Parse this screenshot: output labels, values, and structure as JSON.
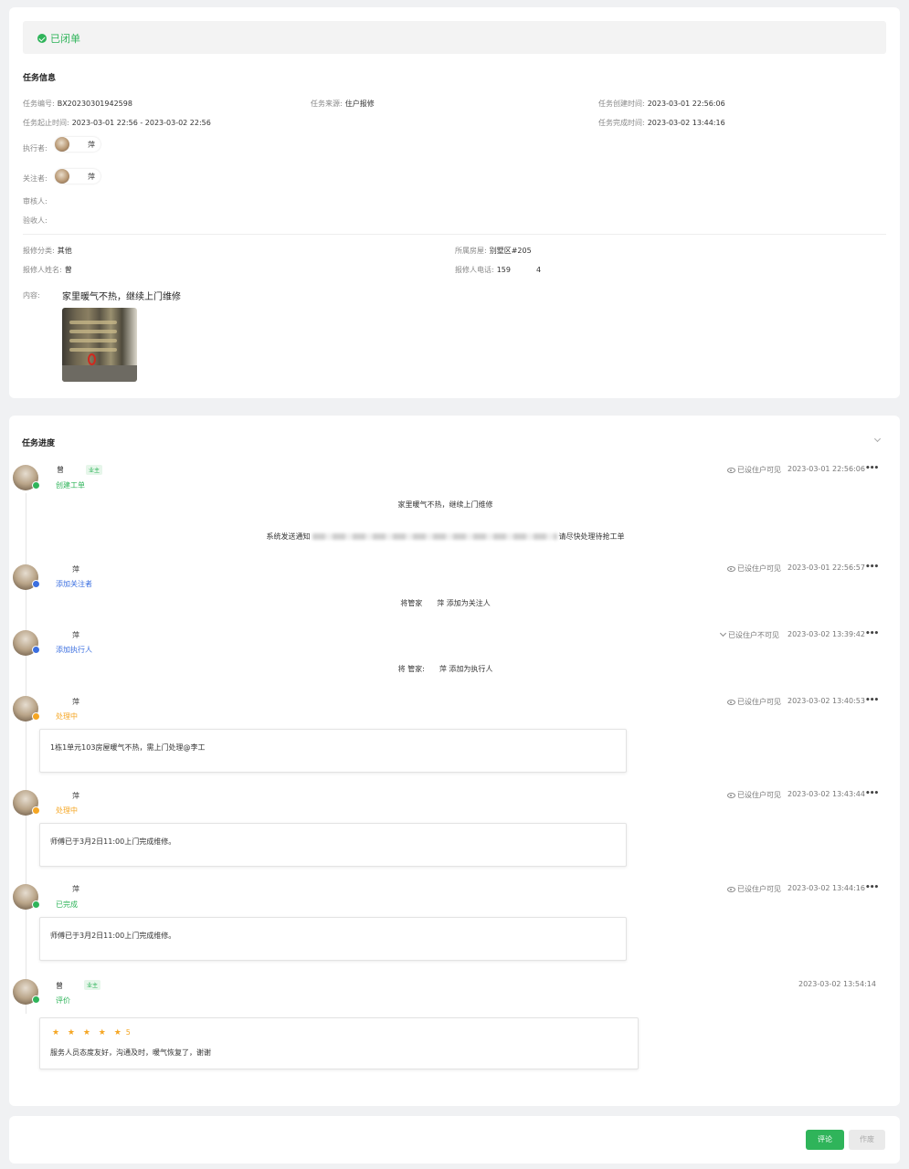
{
  "status": {
    "label": "已闭单",
    "color": "#2fb45a"
  },
  "task_info": {
    "title": "任务信息",
    "task_no_label": "任务编号:",
    "task_no": "BX20230301942598",
    "source_label": "任务来源:",
    "source": "住户报修",
    "created_label": "任务创建时间:",
    "created": "2023-03-01 22:56:06",
    "period_label": "任务起止时间:",
    "period": "2023-03-01 22:56 - 2023-03-02 22:56",
    "finished_label": "任务完成时间:",
    "finished": "2023-03-02 13:44:16",
    "executor_label": "执行者:",
    "executor_name": "萍",
    "follower_label": "关注者:",
    "follower_name": "萍",
    "reviewer_label": "审核人:",
    "acceptor_label": "验收人:",
    "category_label": "报修分类:",
    "category": "其他",
    "house_label": "所属房屋:",
    "house": "别墅区#205",
    "reporter_label": "报修人姓名:",
    "reporter": "曾",
    "phone_label": "报修人电话:",
    "phone_a": "159",
    "phone_b": "4",
    "content_label": "内容:",
    "content": "家里暖气不热，继续上门维修"
  },
  "progress": {
    "title": "任务进度",
    "entries": [
      {
        "name": "曾",
        "tag": "业主",
        "action": "创建工单",
        "visibility": "已设住户可见",
        "time": "2023-03-01 22:56:06",
        "more": "•••"
      },
      {
        "name": "萍",
        "action": "添加关注者",
        "visibility": "已设住户可见",
        "time": "2023-03-01 22:56:57",
        "more": "•••",
        "body": "将管家　　萍 添加为关注人"
      },
      {
        "name": "萍",
        "action": "添加执行人",
        "visibility": "已设住户不可见",
        "time": "2023-03-02 13:39:42",
        "more": "•••",
        "body": "将 管家:　　萍 添加为执行人"
      },
      {
        "name": "萍",
        "action": "处理中",
        "visibility": "已设住户可见",
        "time": "2023-03-02 13:40:53",
        "more": "•••",
        "body": "1栋1单元103房屋暖气不热，需上门处理@李工"
      },
      {
        "name": "萍",
        "action": "处理中",
        "visibility": "已设住户可见",
        "time": "2023-03-02 13:43:44",
        "more": "•••",
        "body": "师傅已于3月2日11:00上门完成维修。"
      },
      {
        "name": "萍",
        "action": "已完成",
        "visibility": "已设住户可见",
        "time": "2023-03-02 13:44:16",
        "more": "•••",
        "body": "师傅已于3月2日11:00上门完成维修。"
      },
      {
        "name": "曾",
        "tag": "业主",
        "action": "评价",
        "time": "2023-03-02 13:54:14",
        "stars": "★ ★ ★ ★ ★",
        "score": "5",
        "body": "服务人员态度友好，沟通及时，暖气恢复了，谢谢"
      }
    ],
    "entry0_line1": "家里暖气不热，继续上门维修",
    "entry0_line2_a": "系统发送通知",
    "entry0_line2_b": "请尽快处理待抢工单"
  },
  "actions": {
    "comment": "评论",
    "void": "作废"
  },
  "colors": {
    "green": "#2fb45a",
    "blue": "#3b6fe0",
    "orange": "#f5a623"
  }
}
